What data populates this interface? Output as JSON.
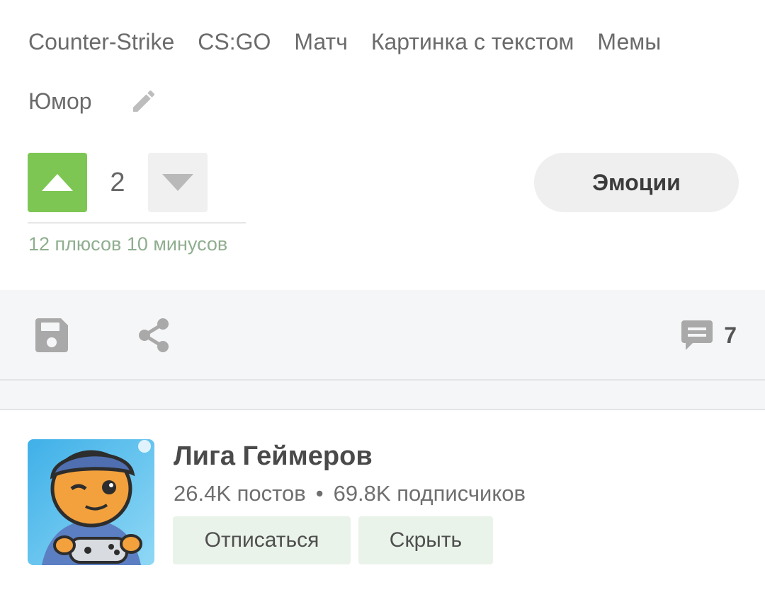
{
  "tags": {
    "row1": [
      "Counter-Strike",
      "CS:GO",
      "Матч",
      "Картинка с текстом",
      "Мемы"
    ],
    "row2": [
      "Юмор"
    ]
  },
  "rating": {
    "count": "2",
    "detail": "12 плюсов 10 минусов"
  },
  "emotions": {
    "label": "Эмоции"
  },
  "actions": {
    "comments_count": "7"
  },
  "community": {
    "name": "Лига Геймеров",
    "posts": "26.4K постов",
    "separator": "•",
    "subscribers": "69.8K подписчиков",
    "unsubscribe_label": "Отписаться",
    "hide_label": "Скрыть"
  },
  "colors": {
    "upvote_active": "#7dc653",
    "rating_detail": "#8fae8f",
    "community_button_bg": "#eaf3ea"
  }
}
